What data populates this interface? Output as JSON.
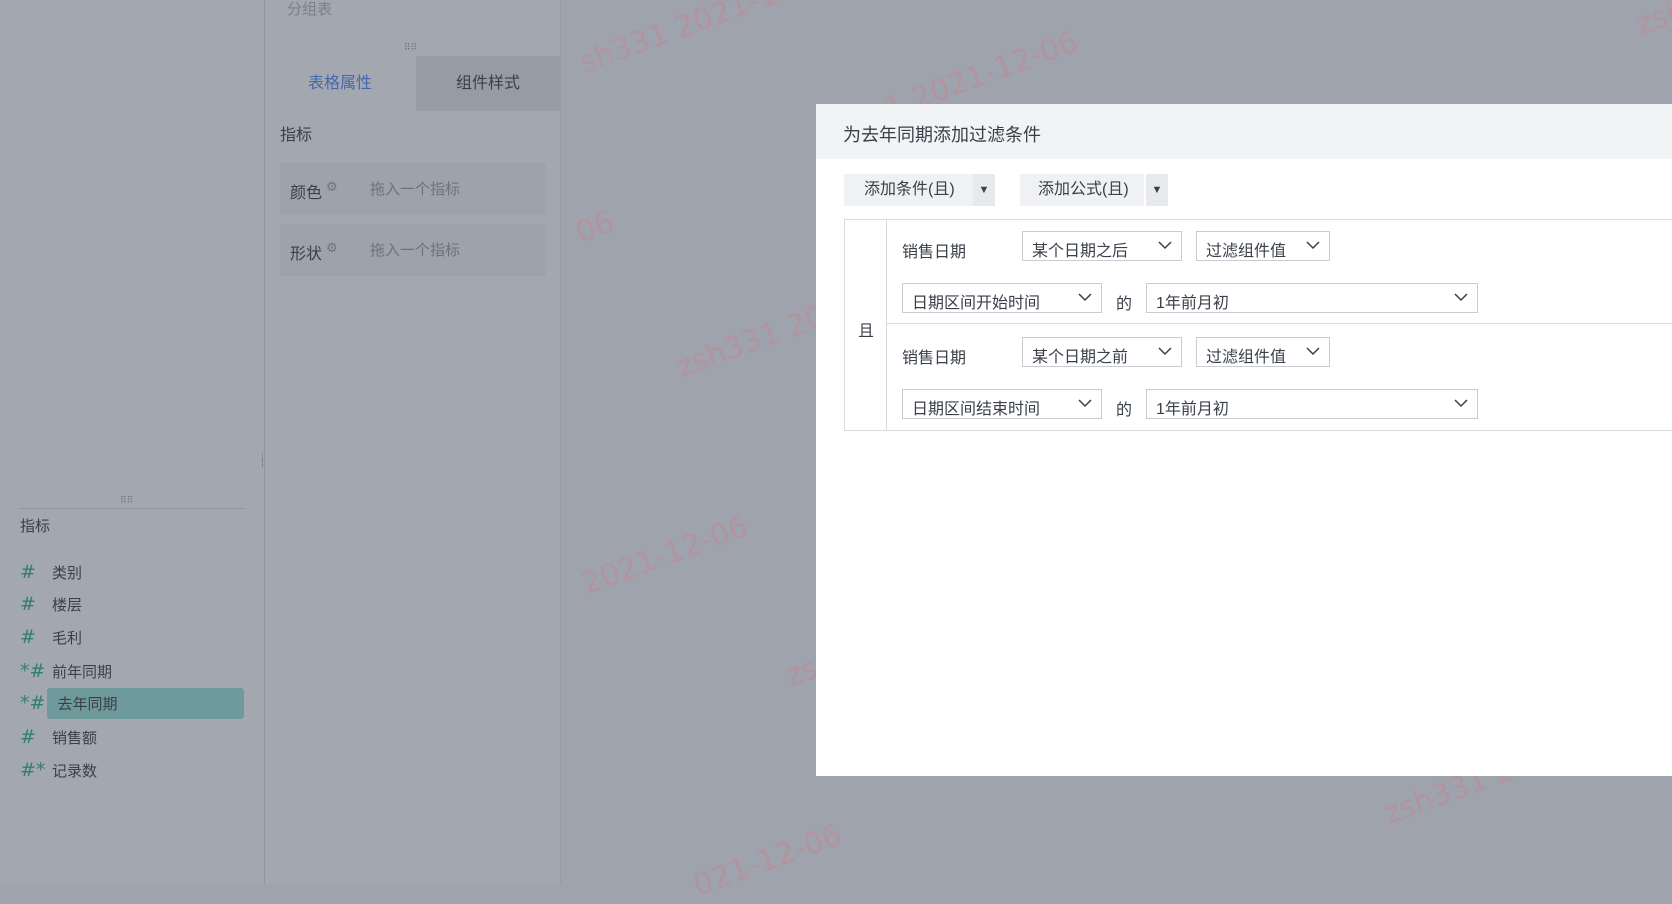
{
  "left_panel": {
    "header": "指标",
    "metrics": [
      {
        "icon": "#",
        "label": "类别"
      },
      {
        "icon": "#",
        "label": "楼层"
      },
      {
        "icon": "#",
        "label": "毛利"
      },
      {
        "icon": "*#",
        "label": "前年同期"
      },
      {
        "icon": "*#",
        "label": "去年同期",
        "selected": true
      },
      {
        "icon": "#",
        "label": "销售额"
      },
      {
        "icon": "#*",
        "label": "记录数"
      }
    ]
  },
  "mid_panel": {
    "top_label": "分组表",
    "tabs": [
      "表格属性",
      "组件样式"
    ],
    "section_title": "指标",
    "drop_rows": [
      {
        "name": "颜色",
        "placeholder": "拖入一个指标"
      },
      {
        "name": "形状",
        "placeholder": "拖入一个指标"
      }
    ]
  },
  "watermark": {
    "user": "zsh331",
    "date": "2021-12-06",
    "fragments": [
      "sh331 2021-12",
      "1 2021-12-06",
      "06",
      "zsh331 2021",
      "2021-12-06",
      "zs",
      "zsh331 202",
      "021-12-06",
      "zsh"
    ]
  },
  "dialog": {
    "title": "为去年同期添加过滤条件",
    "add_condition": "添加条件(且)",
    "add_formula": "添加公式(且)",
    "logic_label": "且",
    "conditions": [
      {
        "field": "销售日期",
        "operator": "某个日期之后",
        "value_type": "过滤组件值",
        "range_point": "日期区间开始时间",
        "of": "的",
        "offset": "1年前月初"
      },
      {
        "field": "销售日期",
        "operator": "某个日期之前",
        "value_type": "过滤组件值",
        "range_point": "日期区间结束时间",
        "of": "的",
        "offset": "1年前月初"
      }
    ]
  },
  "colors": {
    "overlay": "#9ea3ad",
    "accent_tab": "#4468b0",
    "metric_icon": "#357d6f",
    "selected_bg": "#6f9a9c"
  }
}
